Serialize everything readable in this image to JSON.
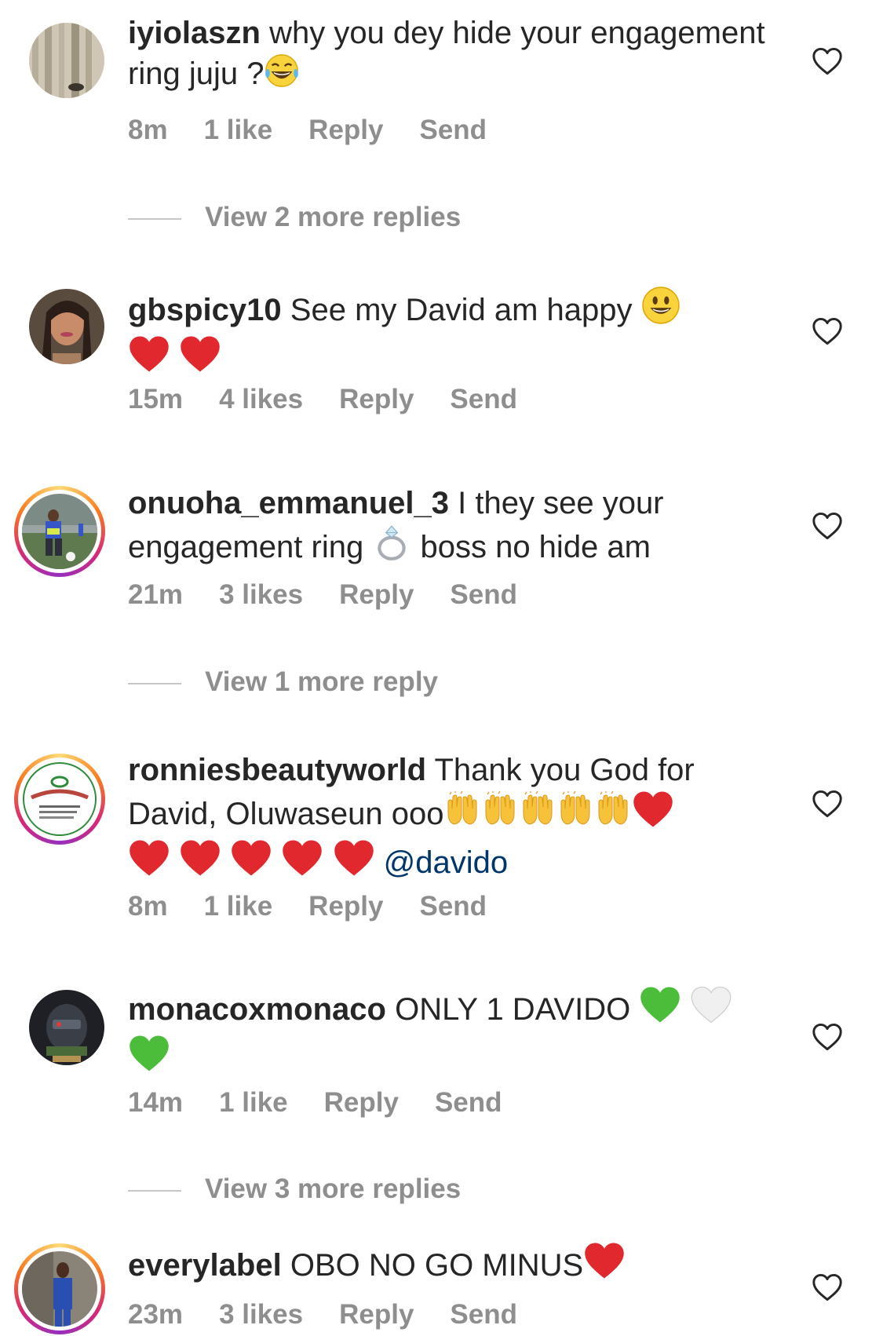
{
  "comments": [
    {
      "username": "iyiolaszn",
      "text": "why you dey hide your engagement ring juju ?",
      "time": "8m",
      "likes": "1 like",
      "reply_label": "Reply",
      "send_label": "Send",
      "view_more": "View 2 more replies"
    },
    {
      "username": "gbspicy10",
      "text": "See my David am happy",
      "time": "15m",
      "likes": "4 likes",
      "reply_label": "Reply",
      "send_label": "Send"
    },
    {
      "username": "onuoha_emmanuel_3",
      "text_part1": "I they see your engagement ring",
      "text_part2": "boss no hide am",
      "time": "21m",
      "likes": "3 likes",
      "reply_label": "Reply",
      "send_label": "Send",
      "view_more": "View 1 more reply"
    },
    {
      "username": "ronniesbeautyworld",
      "text": "Thank you God for David, Oluwaseun ooo",
      "mention": "@davido",
      "time": "8m",
      "likes": "1 like",
      "reply_label": "Reply",
      "send_label": "Send"
    },
    {
      "username": "monacoxmonaco",
      "text": "ONLY 1 DAVIDO",
      "time": "14m",
      "likes": "1 like",
      "reply_label": "Reply",
      "send_label": "Send",
      "view_more": "View 3 more replies"
    },
    {
      "username": "everylabel",
      "text": "OBO NO GO MINUS",
      "time": "23m",
      "likes": "3 likes",
      "reply_label": "Reply",
      "send_label": "Send"
    }
  ],
  "colors": {
    "text": "#262626",
    "meta": "#8e8e8e",
    "mention": "#00376b",
    "heart_red": "#e0282e"
  },
  "icons": [
    "heart-outline-icon",
    "red-heart-emoji",
    "green-heart-emoji",
    "white-heart-emoji",
    "raising-hands-emoji",
    "ring-emoji",
    "grinning-face-emoji",
    "tears-of-joy-emoji"
  ]
}
